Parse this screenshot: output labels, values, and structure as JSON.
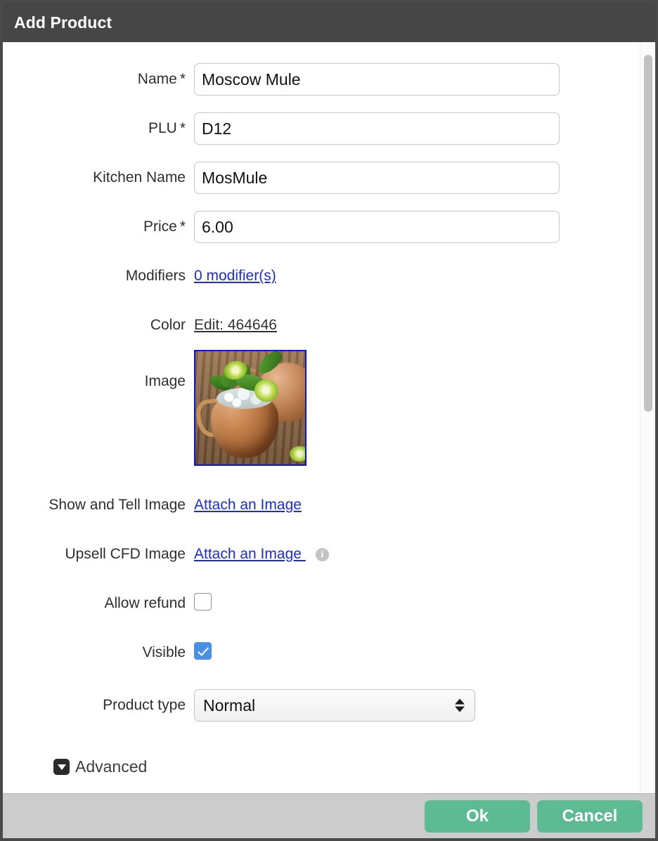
{
  "window": {
    "title": "Add Product"
  },
  "form": {
    "name": {
      "label": "Name",
      "required_mark": "*",
      "value": "Moscow Mule",
      "placeholder": ""
    },
    "plu": {
      "label": "PLU",
      "required_mark": "*",
      "value": "D12",
      "placeholder": ""
    },
    "kitchen_name": {
      "label": "Kitchen Name",
      "value": "MosMule",
      "placeholder": ""
    },
    "price": {
      "label": "Price",
      "required_mark": "*",
      "value": "6.00",
      "placeholder": ""
    },
    "modifiers": {
      "label": "Modifiers",
      "link_text": "0 modifier(s)",
      "link_color": "#1a2ae0"
    },
    "color": {
      "label": "Color",
      "link_text": "Edit: 464646",
      "value_hex": "#464646"
    },
    "image": {
      "label": "Image",
      "alt": "moscow-mule-cocktail-thumbnail",
      "border_color": "#0a14d8"
    },
    "show_and_tell_image": {
      "label": "Show and Tell Image",
      "link_text": "Attach an Image"
    },
    "upsell_cfd_image": {
      "label": "Upsell CFD Image",
      "link_text": "Attach an Image ",
      "info_icon": "info-icon",
      "info_glyph": "i"
    },
    "allow_refund": {
      "label": "Allow refund",
      "checked": false
    },
    "visible": {
      "label": "Visible",
      "checked": true,
      "check_color": "#4a90e6"
    },
    "product_type": {
      "label": "Product type",
      "selected": "Normal",
      "options": [
        "Normal"
      ]
    }
  },
  "advanced": {
    "label": "Advanced",
    "icon": "disclosure-triangle-down-icon",
    "expanded": false
  },
  "footer": {
    "ok_label": "Ok",
    "cancel_label": "Cancel",
    "button_color": "#5cbb92",
    "bar_color": "#cccccc"
  },
  "scrollbar": {
    "orientation": "vertical",
    "thumb_name": "scroll-thumb"
  }
}
